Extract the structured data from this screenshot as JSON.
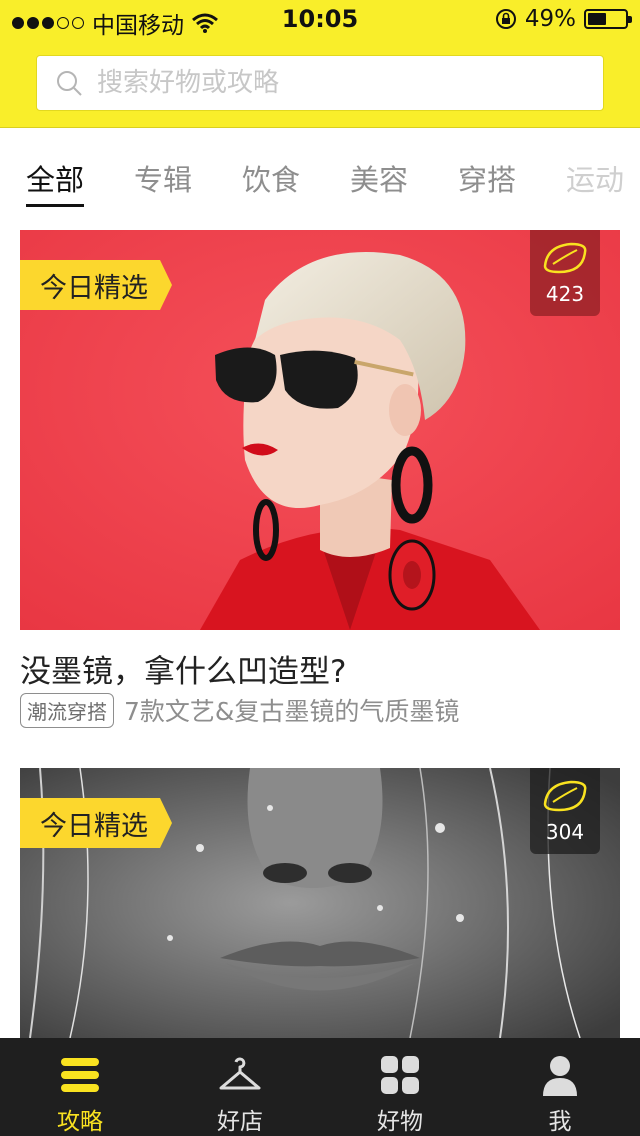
{
  "status_bar": {
    "carrier": "中国移动",
    "time": "10:05",
    "battery": "49%",
    "battery_level": 0.49,
    "signal_bars": 3,
    "signal_total": 5
  },
  "search": {
    "placeholder": "搜索好物或攻略"
  },
  "tabs": [
    {
      "label": "全部",
      "active": true
    },
    {
      "label": "专辑",
      "active": false
    },
    {
      "label": "饮食",
      "active": false
    },
    {
      "label": "美容",
      "active": false
    },
    {
      "label": "穿搭",
      "active": false
    },
    {
      "label": "运动",
      "active": false
    }
  ],
  "cards": [
    {
      "tag": "今日精选",
      "likes": "423",
      "title": "没墨镜，拿什么凹造型?",
      "category": "潮流穿搭",
      "description": "7款文艺&复古墨镜的气质墨镜",
      "image_description": "woman with sunglasses on red background"
    },
    {
      "tag": "今日精选",
      "likes": "304",
      "image_description": "black and white close-up of face with water drops"
    }
  ],
  "bottom_nav": [
    {
      "label": "攻略",
      "icon": "guide-icon",
      "active": true
    },
    {
      "label": "好店",
      "icon": "hanger-icon",
      "active": false
    },
    {
      "label": "好物",
      "icon": "grid-icon",
      "active": false
    },
    {
      "label": "我",
      "icon": "person-icon",
      "active": false
    }
  ],
  "colors": {
    "brand_yellow": "#f9ee2a",
    "tag_yellow": "#fcd72d",
    "nav_active": "#f9e220",
    "nav_bg": "#1f1f1f"
  }
}
